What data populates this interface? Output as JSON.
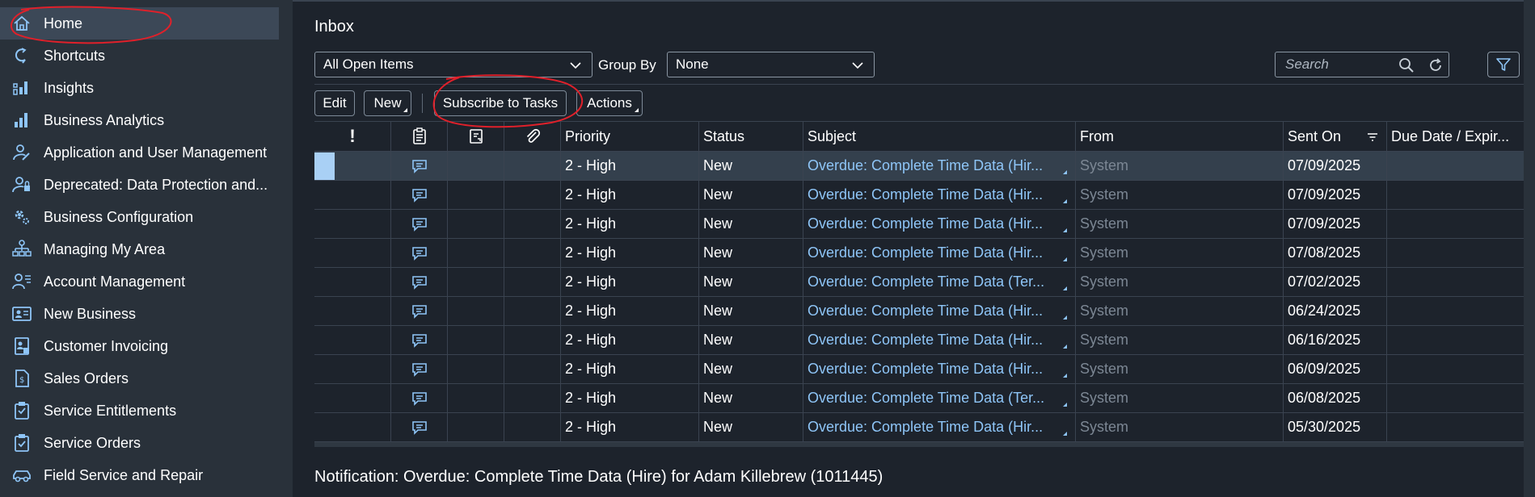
{
  "sidebar": {
    "items": [
      {
        "label": "Home",
        "icon": "home-icon",
        "active": true
      },
      {
        "label": "Shortcuts",
        "icon": "shortcut-icon"
      },
      {
        "label": "Insights",
        "icon": "insights-icon"
      },
      {
        "label": "Business Analytics",
        "icon": "bar-chart-icon"
      },
      {
        "label": "Application and User Management",
        "icon": "user-edit-icon"
      },
      {
        "label": "Deprecated: Data Protection and...",
        "icon": "user-lock-icon"
      },
      {
        "label": "Business Configuration",
        "icon": "gears-icon"
      },
      {
        "label": "Managing My Area",
        "icon": "org-chart-icon"
      },
      {
        "label": "Account Management",
        "icon": "account-icon"
      },
      {
        "label": "New Business",
        "icon": "id-card-icon"
      },
      {
        "label": "Customer Invoicing",
        "icon": "invoice-icon"
      },
      {
        "label": "Sales Orders",
        "icon": "sales-order-icon"
      },
      {
        "label": "Service Entitlements",
        "icon": "clipboard-icon"
      },
      {
        "label": "Service Orders",
        "icon": "clipboard-check-icon"
      },
      {
        "label": "Field Service and Repair",
        "icon": "car-icon"
      }
    ]
  },
  "main": {
    "title": "Inbox",
    "view_select": "All Open Items",
    "group_by_label": "Group By",
    "group_by_select": "None",
    "search_placeholder": "Search",
    "toolbar": {
      "edit": "Edit",
      "new": "New",
      "subscribe": "Subscribe to Tasks",
      "actions": "Actions"
    },
    "columns": [
      "!",
      "",
      "",
      "",
      "Priority",
      "Status",
      "Subject",
      "From",
      "Sent On",
      "Due Date / Expir..."
    ],
    "rows": [
      {
        "priority": "2 - High",
        "status": "New",
        "subject": "Overdue: Complete Time Data (Hir...",
        "from": "System",
        "sent_on": "07/09/2025",
        "due": "",
        "selected": true
      },
      {
        "priority": "2 - High",
        "status": "New",
        "subject": "Overdue: Complete Time Data (Hir...",
        "from": "System",
        "sent_on": "07/09/2025",
        "due": ""
      },
      {
        "priority": "2 - High",
        "status": "New",
        "subject": "Overdue: Complete Time Data (Hir...",
        "from": "System",
        "sent_on": "07/09/2025",
        "due": ""
      },
      {
        "priority": "2 - High",
        "status": "New",
        "subject": "Overdue: Complete Time Data (Hir...",
        "from": "System",
        "sent_on": "07/08/2025",
        "due": ""
      },
      {
        "priority": "2 - High",
        "status": "New",
        "subject": "Overdue: Complete Time Data (Ter...",
        "from": "System",
        "sent_on": "07/02/2025",
        "due": ""
      },
      {
        "priority": "2 - High",
        "status": "New",
        "subject": "Overdue: Complete Time Data (Hir...",
        "from": "System",
        "sent_on": "06/24/2025",
        "due": ""
      },
      {
        "priority": "2 - High",
        "status": "New",
        "subject": "Overdue: Complete Time Data (Hir...",
        "from": "System",
        "sent_on": "06/16/2025",
        "due": ""
      },
      {
        "priority": "2 - High",
        "status": "New",
        "subject": "Overdue: Complete Time Data (Hir...",
        "from": "System",
        "sent_on": "06/09/2025",
        "due": ""
      },
      {
        "priority": "2 - High",
        "status": "New",
        "subject": "Overdue: Complete Time Data (Ter...",
        "from": "System",
        "sent_on": "06/08/2025",
        "due": ""
      },
      {
        "priority": "2 - High",
        "status": "New",
        "subject": "Overdue: Complete Time Data (Hir...",
        "from": "System",
        "sent_on": "05/30/2025",
        "due": ""
      }
    ],
    "notification": "Notification: Overdue: Complete Time Data (Hire) for Adam Killebrew (1011445)"
  },
  "colors": {
    "background": "#1d232c",
    "sidebar": "#29313a",
    "sidebar_active": "#3c4857",
    "link": "#8ec5f7",
    "selection": "#a9d0f5",
    "annotation": "#e0202a"
  }
}
